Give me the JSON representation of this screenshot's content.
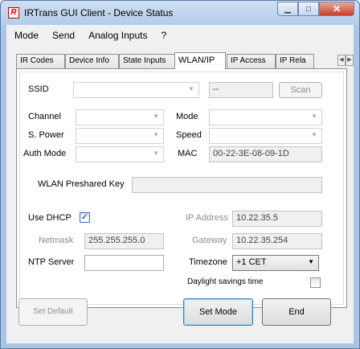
{
  "window": {
    "title": "IRTrans GUI Client - Device Status",
    "icon_letter": "R",
    "minimize_glyph": "▁",
    "maximize_glyph": "□",
    "close_glyph": "✕"
  },
  "menu": [
    "Mode",
    "Send",
    "Analog Inputs",
    "?"
  ],
  "tabs": [
    "IR Codes",
    "Device Info",
    "State Inputs",
    "WLAN/IP",
    "IP Access",
    "IP Rela"
  ],
  "tab_scroll": {
    "left": "◀",
    "right": "▶"
  },
  "wlan": {
    "ssid_label": "SSID",
    "ssid_value": "",
    "ssid_readout": "--",
    "scan_button": "Scan",
    "channel_label": "Channel",
    "channel_value": "",
    "mode_label": "Mode",
    "mode_value": "",
    "spower_label": "S. Power",
    "spower_value": "",
    "speed_label": "Speed",
    "speed_value": "",
    "auth_label": "Auth Mode",
    "auth_value": "",
    "mac_label": "MAC",
    "mac_value": "00-22-3E-08-09-1D",
    "psk_label": "WLAN Preshared Key",
    "psk_value": ""
  },
  "ip": {
    "dhcp_label": "Use DHCP",
    "dhcp_checked": true,
    "check_glyph": "✓",
    "ip_label": "IP Address",
    "ip_value": "10.22.35.5",
    "netmask_label": "Netmask",
    "netmask_value": "255.255.255.0",
    "gateway_label": "Gateway",
    "gateway_value": "10.22.35.254",
    "ntp_label": "NTP Server",
    "ntp_value": "",
    "timezone_label": "Timezone",
    "timezone_value": "+1 CET",
    "dst_label": "Daylight savings time",
    "dst_checked": false
  },
  "buttons": {
    "set_default": "Set Default",
    "set_mode": "Set Mode",
    "end": "End"
  },
  "dropdown_glyph": "▼"
}
